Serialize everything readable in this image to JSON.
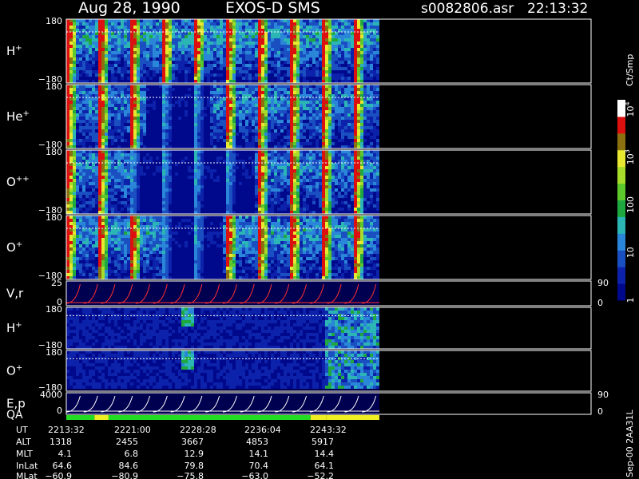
{
  "header": {
    "date": "Aug 28, 1990",
    "instrument": "EXOS-D SMS",
    "file": "s0082806.asr",
    "time": "22:13:32"
  },
  "colorbar": {
    "unit": "Ct/Smp",
    "ticks": [
      {
        "label": "10",
        "sup": "4",
        "value": 10000
      },
      {
        "label": "10",
        "sup": "3",
        "value": 1000
      },
      {
        "label": "100",
        "sup": "",
        "value": 100
      },
      {
        "label": "10",
        "sup": "",
        "value": 10
      },
      {
        "label": "1",
        "sup": "",
        "value": 1
      }
    ]
  },
  "side_label": "Sep-00 2AA31L",
  "chart_data": {
    "type": "heatmap",
    "panels": [
      {
        "id": "h-plus",
        "label": "H",
        "sup": "+",
        "ymax": "180",
        "ymin": "−180",
        "style": "spin",
        "intensity": 1.0,
        "red": 0.45,
        "quiet": [
          0,
          0
        ]
      },
      {
        "id": "he-plus",
        "label": "He",
        "sup": "+",
        "ymax": "180",
        "ymin": "−180",
        "style": "spin",
        "intensity": 0.8,
        "red": 0.0,
        "quiet": [
          0.25,
          0.45
        ]
      },
      {
        "id": "o-plusplus",
        "label": "O",
        "sup": "++",
        "ymax": "180",
        "ymin": "−180",
        "style": "spin",
        "intensity": 0.8,
        "red": 0.0,
        "quiet": [
          0.2,
          0.6
        ]
      },
      {
        "id": "o-plus",
        "label": "O",
        "sup": "+",
        "ymax": "180",
        "ymin": "−180",
        "style": "spin",
        "intensity": 0.95,
        "red": 0.0,
        "quiet": [
          0.3,
          0.5
        ]
      },
      {
        "id": "vr",
        "label": "V,r",
        "sup": "",
        "ymax": "25",
        "ymin": "0",
        "rmax": "90",
        "rmin": "0",
        "style": "line-red"
      },
      {
        "id": "h-plus-2",
        "label": "H",
        "sup": "+",
        "ymax": "180",
        "ymin": "−180",
        "style": "flat",
        "intensity": 0.2,
        "red": 0.0
      },
      {
        "id": "o-plus-2",
        "label": "O",
        "sup": "+",
        "ymax": "180",
        "ymin": "−180",
        "style": "flat",
        "intensity": 0.25,
        "red": 0.0
      },
      {
        "id": "ep",
        "label": "E,p",
        "sup": "",
        "ymax": "4000",
        "ymin": "0",
        "rmax": "90",
        "rmin": "0",
        "style": "line-white"
      }
    ],
    "qa": {
      "label": "QA",
      "segments": [
        {
          "start": 0.0,
          "end": 0.09,
          "color": "#22dd22"
        },
        {
          "start": 0.09,
          "end": 0.135,
          "color": "#eeee22"
        },
        {
          "start": 0.135,
          "end": 0.78,
          "color": "#22dd22"
        },
        {
          "start": 0.78,
          "end": 0.83,
          "color": "#eeee22"
        },
        {
          "start": 0.83,
          "end": 1.0,
          "color": "#eeee22"
        }
      ]
    },
    "ephemeris": {
      "labels": [
        "UT",
        "ALT",
        "MLT",
        "InLat",
        "MLat"
      ],
      "columns": [
        {
          "UT": "2213:32",
          "ALT": "1318",
          "MLT": "4.1",
          "InLat": "64.6",
          "MLat": "−60.9"
        },
        {
          "UT": "2221:00",
          "ALT": "2455",
          "MLT": "6.8",
          "InLat": "84.6",
          "MLat": "−80.9"
        },
        {
          "UT": "2228:28",
          "ALT": "3667",
          "MLT": "12.9",
          "InLat": "79.8",
          "MLat": "−75.8"
        },
        {
          "UT": "2236:04",
          "ALT": "4853",
          "MLT": "14.1",
          "InLat": "70.4",
          "MLat": "−63.0"
        },
        {
          "UT": "2243:32",
          "ALT": "5917",
          "MLT": "14.4",
          "InLat": "64.1",
          "MLat": "−52.2"
        }
      ]
    }
  }
}
